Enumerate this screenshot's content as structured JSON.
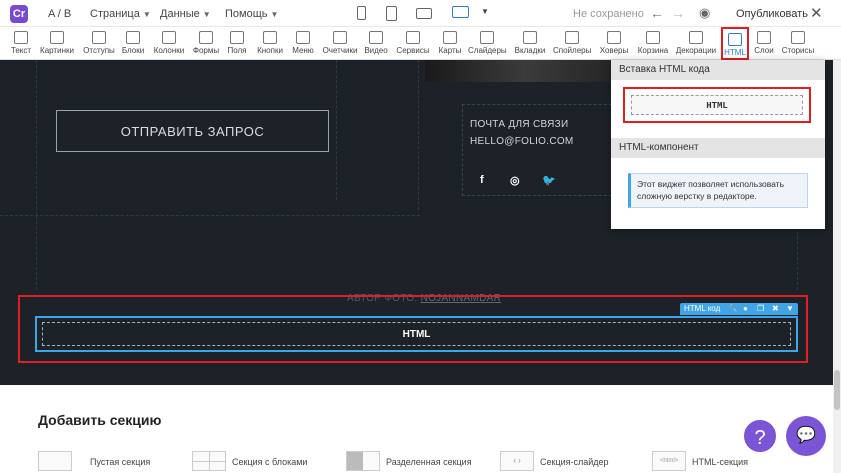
{
  "topbar": {
    "logo": "Cr",
    "ab": "A / B",
    "page_menu": "Страница",
    "data_menu": "Данные",
    "help_menu": "Помощь",
    "status": "Не сохранено",
    "publish": "Опубликовать",
    "close": "✕"
  },
  "toolbar": {
    "items": [
      "Текст",
      "Картинки",
      "Отступы",
      "Блоки",
      "Колонки",
      "Формы",
      "Поля",
      "Кнопки",
      "Меню",
      "Очетчики",
      "Видео",
      "Сервисы",
      "Карты",
      "Слайдеры",
      "Вкладки",
      "Спойлеры",
      "Ховеры",
      "Корзина",
      "Декорации",
      "HTML",
      "Слои",
      "Сторисы"
    ],
    "active": "HTML"
  },
  "canvas": {
    "send_button": "ОТПРАВИТЬ ЗАПРОС",
    "contact_line1": "ПОЧТА ДЛЯ СВЯЗИ",
    "contact_line2": "HELLO@FOLIO.COM",
    "social": [
      "f",
      "◎",
      "🐦"
    ],
    "author_prefix": "АВТОР ФОТО:",
    "author_name": "NOJANNAMDAR",
    "html_label": "HTML",
    "component_bar_label": "HTML код"
  },
  "panel": {
    "section1_title": "Вставка HTML кода",
    "html_widget": "HTML",
    "section2_title": "HTML-компонент",
    "description": "Этот виджет позволяет использовать сложную верстку в редакторе."
  },
  "bottom": {
    "title": "Добавить секцию",
    "options": [
      "Пустая секция",
      "Секция с блоками",
      "Разделенная секция",
      "Секция-слайдер",
      "HTML-секция"
    ],
    "slider_arrows": "‹  ›",
    "html_thumb": "<html>"
  },
  "help": "?",
  "chat": "💬"
}
